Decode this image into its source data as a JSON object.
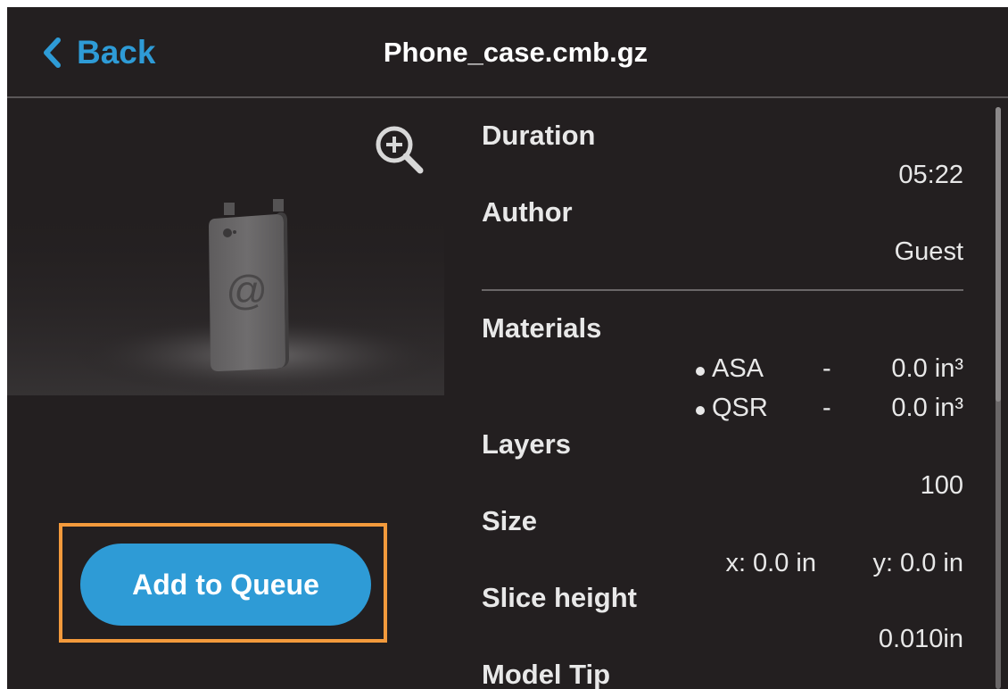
{
  "header": {
    "back_label": "Back",
    "title": "Phone_case.cmb.gz"
  },
  "preview": {
    "zoom_icon": "zoom-in-icon",
    "model": "phone-case-render",
    "logo_glyph": "@"
  },
  "actions": {
    "add_to_queue_label": "Add to Queue"
  },
  "details": {
    "duration": {
      "label": "Duration",
      "value": "05:22"
    },
    "author": {
      "label": "Author",
      "value": "Guest"
    },
    "materials": {
      "label": "Materials",
      "items": [
        {
          "name": "ASA",
          "separator": "-",
          "amount": "0.0 in³"
        },
        {
          "name": "QSR",
          "separator": "-",
          "amount": "0.0 in³"
        }
      ]
    },
    "layers": {
      "label": "Layers",
      "value": "100"
    },
    "size": {
      "label": "Size",
      "x": "x: 0.0 in",
      "y": "y: 0.0 in"
    },
    "slice_height": {
      "label": "Slice height",
      "value": "0.010in"
    },
    "model_tip": {
      "label": "Model Tip"
    }
  },
  "colors": {
    "background": "#231f20",
    "accent": "#2e9bd6",
    "highlight": "#f39a3c"
  }
}
